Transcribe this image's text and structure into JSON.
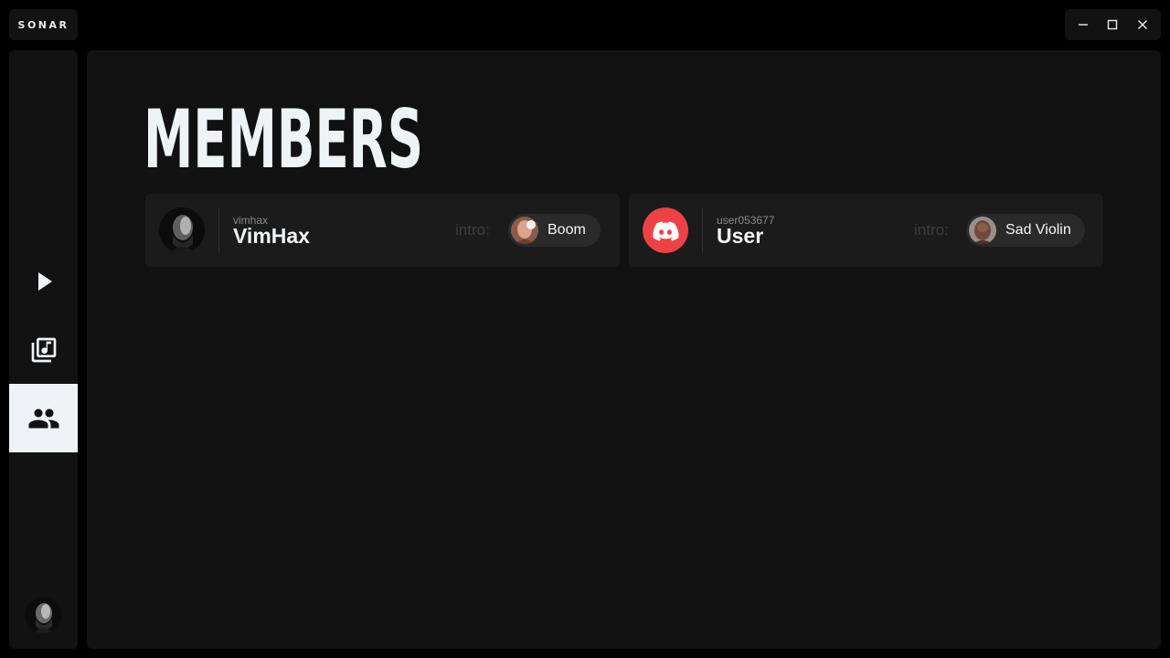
{
  "app": {
    "title": "SONAR"
  },
  "window_controls": {
    "minimize_icon": "minimize-icon",
    "maximize_icon": "maximize-icon",
    "close_icon": "close-icon"
  },
  "sidebar": {
    "items": [
      {
        "id": "play",
        "icon": "play-icon",
        "active": false
      },
      {
        "id": "library",
        "icon": "music-library-icon",
        "active": false
      },
      {
        "id": "members",
        "icon": "people-icon",
        "active": true
      }
    ],
    "profile_icon": "profile-avatar"
  },
  "main": {
    "page_title": "MEMBERS",
    "members": [
      {
        "username": "vimhax",
        "display_name": "VimHax",
        "avatar": "user-photo",
        "intro_label": "intro:",
        "intro_sound": "Boom"
      },
      {
        "username": "user053677",
        "display_name": "User",
        "avatar": "discord-icon",
        "intro_label": "intro:",
        "intro_sound": "Sad Violin"
      }
    ]
  },
  "colors": {
    "background": "#000000",
    "panel": "#121212",
    "main": "#111111",
    "card": "#1b1b1b",
    "chip": "#2a2a2a",
    "accent_light": "#eef3f6",
    "discord_red": "#ed4245",
    "muted_text": "#3e3e3e"
  }
}
